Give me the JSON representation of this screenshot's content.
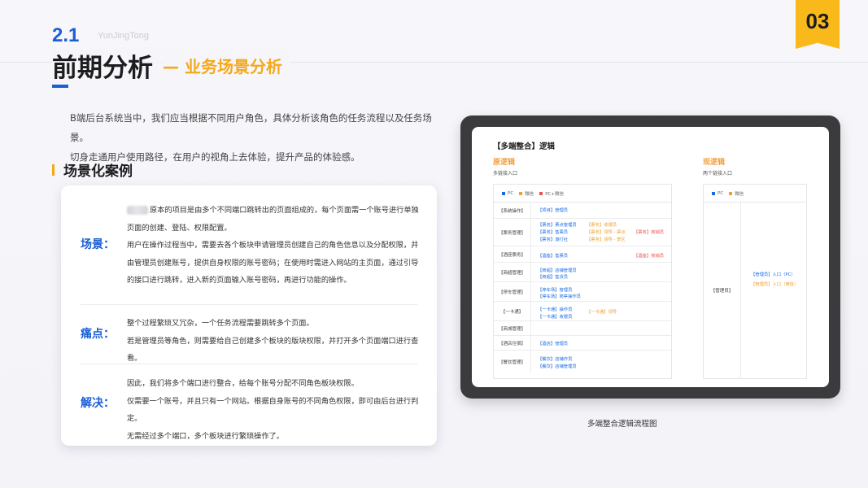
{
  "header": {
    "section_number": "2.1",
    "brand": "YunJingTong",
    "title": "前期分析",
    "subtitle": "— 业务场景分析",
    "page_badge": "03"
  },
  "intro": {
    "line1": "B端后台系统当中，我们应当根据不同用户角色，具体分析该角色的任务流程以及任务场景。",
    "line2": "切身走通用户使用路径，在用户的视角上去体验，提升产品的体验感。"
  },
  "case_heading": "场景化案例",
  "case_card": {
    "scenario": {
      "label": "场景：",
      "lines": [
        "原本的项目是由多个不同端口跳转出的页面组成的，每个页面需一个账号进行单独",
        "页面的创建、登陆、权限配置。",
        "用户在操作过程当中，需要去各个板块申请管理员创建自己的角色信息以及分配权限，并",
        "由管理员创建账号，提供自身权限的账号密码；在使用时需进入网站的主页面，通过引导",
        "的接口进行跳转，进入新的页面输入账号密码，再进行功能的操作。"
      ]
    },
    "pain": {
      "label": "痛点：",
      "lines": [
        "整个过程繁琐又冗杂，一个任务流程需要跳转多个页面。",
        "若是管理员等角色，则需要给自己创建多个板块的版块权限，并打开多个页面端口进行查看。"
      ]
    },
    "solution": {
      "label": "解决：",
      "lines": [
        "因此，我们将多个端口进行整合，给每个账号分配不同角色板块权限。",
        "仅需要一个账号，并且只有一个网站。根据自身账号的不同角色权限，即可由后台进行判定。",
        "无需经过多个端口，多个板块进行繁琐操作了。"
      ]
    }
  },
  "diagram": {
    "title": "【多端整合】逻辑",
    "original": {
      "heading": "原逻辑",
      "sub": "多链接入口",
      "legend": [
        {
          "label": "PC",
          "color": "#1a6be0"
        },
        {
          "label": "微信",
          "color": "#f0a030"
        },
        {
          "label": "PC+微信",
          "color": "#e8554d"
        }
      ],
      "rows": [
        {
          "key": "【系统操作】",
          "tags": [
            [
              "【项目】管理员",
              "blue"
            ]
          ]
        },
        {
          "key": "【票务管理】",
          "tags": [
            [
              "【票务】票点管理员",
              "blue"
            ],
            [
              "【票务】收银员",
              "orange"
            ],
            [
              "【票务】售票员",
              "blue"
            ],
            [
              "【票务】领导 - 票点",
              "orange"
            ],
            [
              "【票务】核销员",
              "red"
            ],
            [
              "【票务】旅行社",
              "blue"
            ],
            [
              "【票务】领导 - 景区",
              "orange"
            ]
          ]
        },
        {
          "key": "【酒座票务】",
          "tags": [
            [
              "【酒座】售票员",
              "blue"
            ],
            [
              "【酒座】核销员",
              "red"
            ]
          ]
        },
        {
          "key": "【商超管理】",
          "tags": [
            [
              "【商超】店铺管理员",
              "blue"
            ],
            [
              "【商超】售货员",
              "blue"
            ]
          ]
        },
        {
          "key": "【停车管理】",
          "tags": [
            [
              "【停车场】管理员",
              "blue"
            ],
            [
              "【停车场】岗亭操作员",
              "blue"
            ]
          ]
        },
        {
          "key": "【一卡通】",
          "tags": [
            [
              "【一卡通】操作员",
              "blue"
            ],
            [
              "【一卡通】领导",
              "orange"
            ],
            [
              "【一卡通】收银员",
              "blue"
            ]
          ]
        },
        {
          "key": "【商城管理】",
          "tags": []
        },
        {
          "key": "【酒店住宿】",
          "tags": [
            [
              "【酒店】管理员",
              "blue"
            ]
          ]
        },
        {
          "key": "【餐饮管理】",
          "tags": [
            [
              "【餐饮】店铺作员",
              "blue"
            ],
            [
              "【餐饮】店铺管理员",
              "blue"
            ]
          ]
        }
      ]
    },
    "current": {
      "heading": "现逻辑",
      "sub": "两个链接入口",
      "legend": [
        {
          "label": "PC",
          "color": "#1a6be0"
        },
        {
          "label": "微信",
          "color": "#f0a030"
        }
      ],
      "key": "【管理员】",
      "tags": [
        [
          "【管理员】入口（PC）",
          "blue"
        ],
        [
          "【管理员】入口（微信）",
          "orange"
        ]
      ]
    },
    "caption": "多端整合逻辑流程图"
  }
}
